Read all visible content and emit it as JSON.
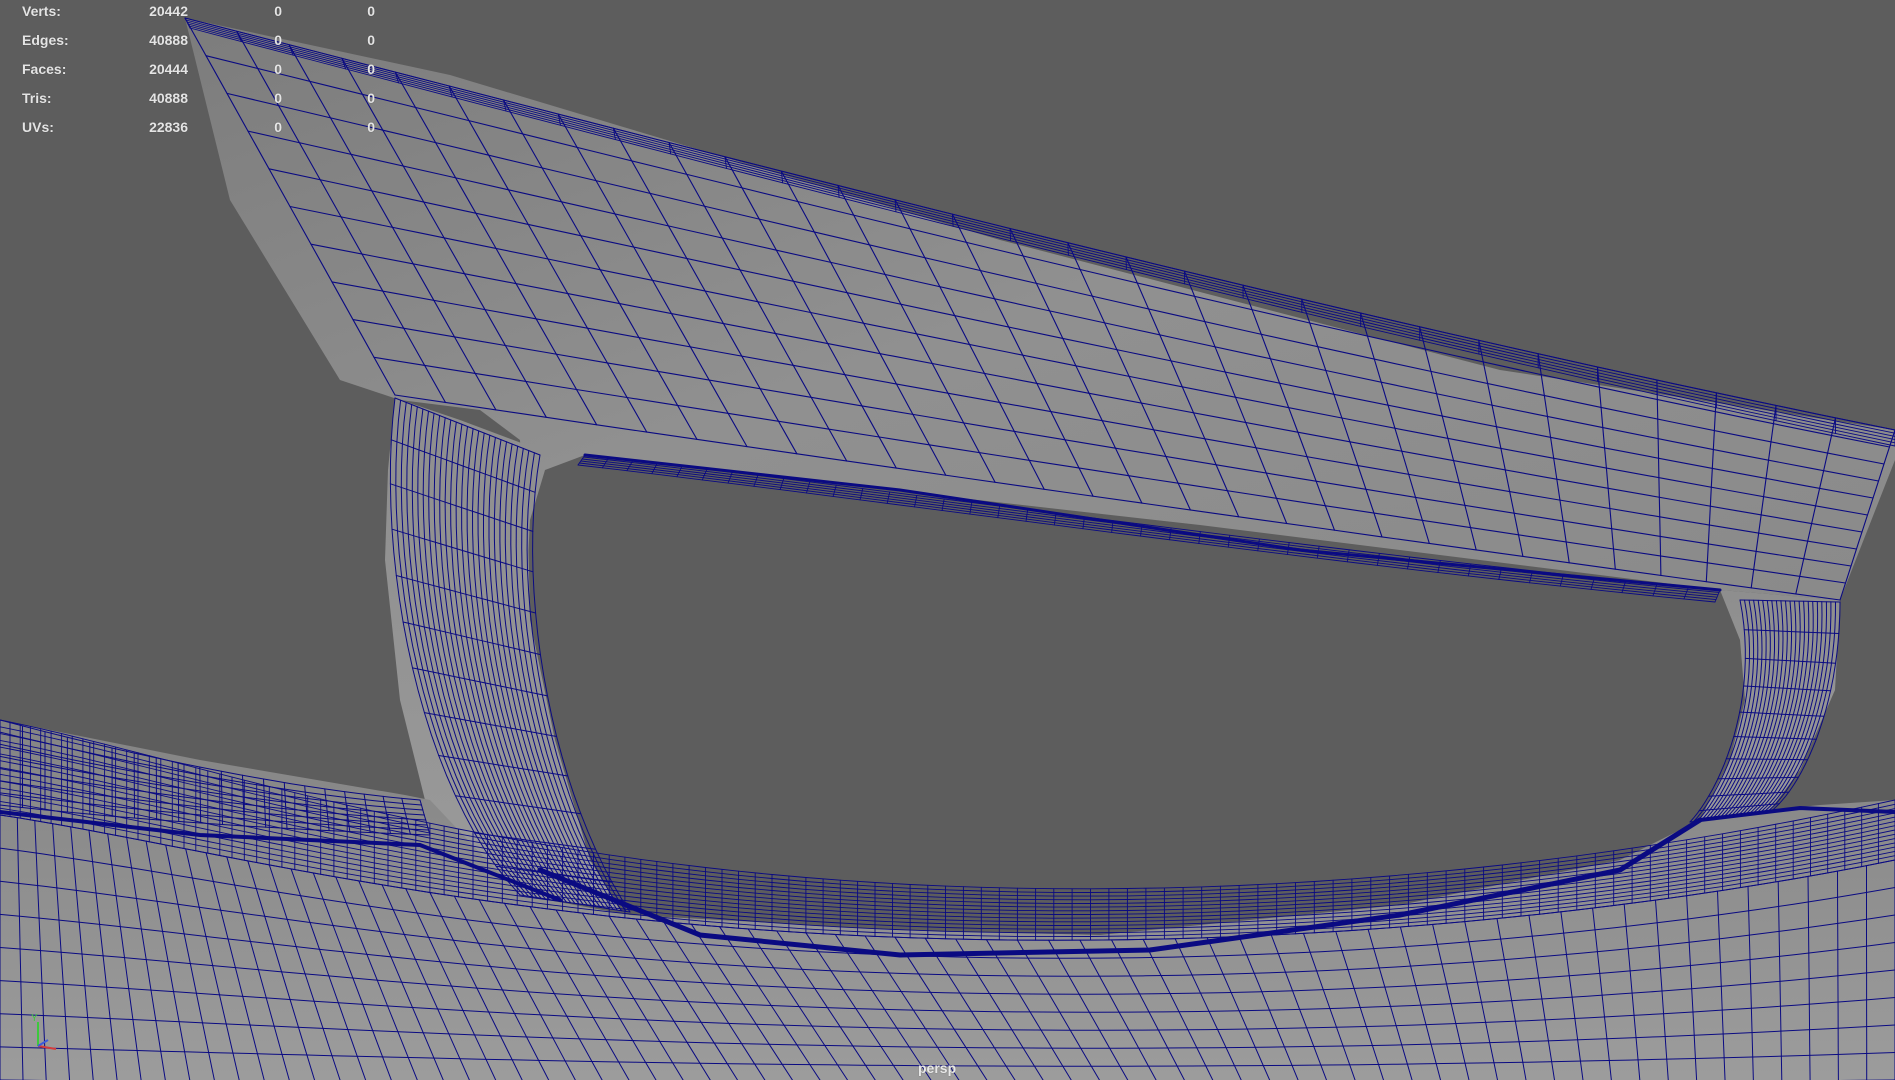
{
  "viewport": {
    "camera": "persp",
    "background_color": "#5d5d5d",
    "wire_color": "#0a0a82",
    "surface_color": "#8a8a8a"
  },
  "hud": {
    "rows": [
      {
        "label": "Verts:",
        "total": "20442",
        "selected": "0",
        "component": "0"
      },
      {
        "label": "Edges:",
        "total": "40888",
        "selected": "0",
        "component": "0"
      },
      {
        "label": "Faces:",
        "total": "20444",
        "selected": "0",
        "component": "0"
      },
      {
        "label": "Tris:",
        "total": "40888",
        "selected": "0",
        "component": "0"
      },
      {
        "label": "UVs:",
        "total": "22836",
        "selected": "0",
        "component": "0"
      }
    ]
  },
  "axis_gizmo": {
    "y_label": "Y",
    "x_color": "#d23c3c",
    "y_color": "#3cc83c",
    "z_color": "#3c5adc"
  }
}
